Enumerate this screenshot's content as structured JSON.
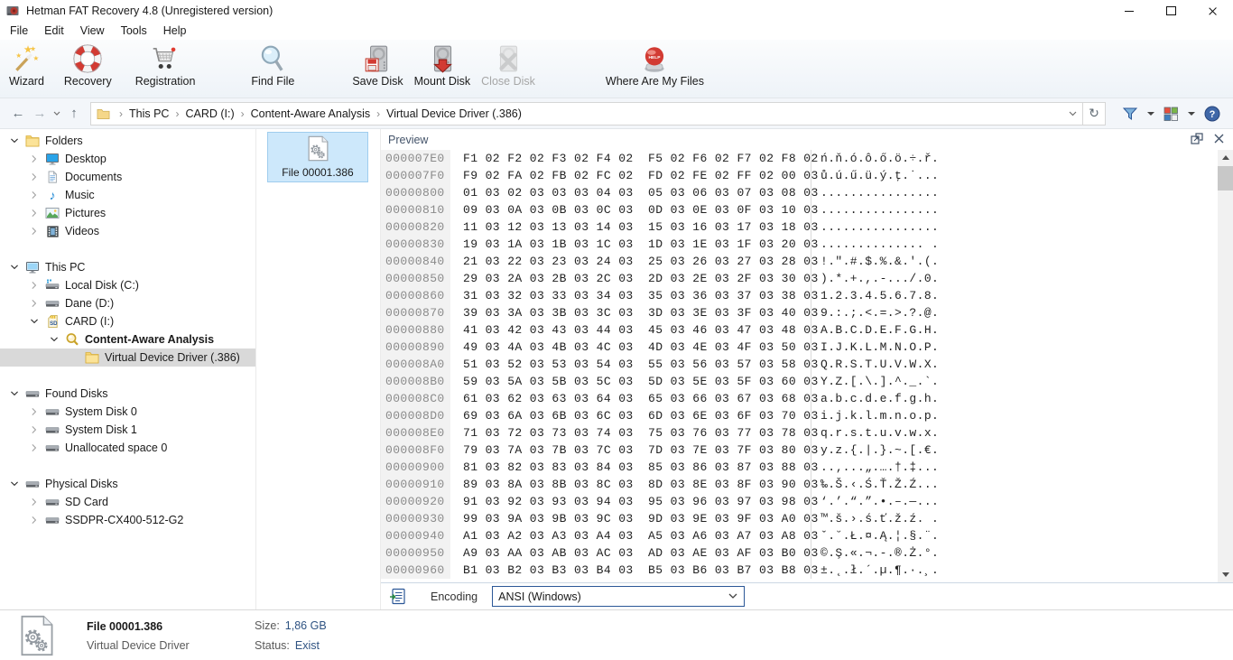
{
  "window": {
    "title": "Hetman FAT Recovery 4.8 (Unregistered version)"
  },
  "menu": {
    "items": [
      "File",
      "Edit",
      "View",
      "Tools",
      "Help"
    ]
  },
  "toolbar": {
    "buttons": [
      {
        "name": "wizard",
        "label": "Wizard",
        "icon": "wizard"
      },
      {
        "name": "recovery",
        "label": "Recovery",
        "icon": "recovery"
      },
      {
        "name": "registration",
        "label": "Registration",
        "icon": "registration"
      },
      {
        "name": "find-file",
        "label": "Find File",
        "icon": "find-file"
      },
      {
        "name": "save-disk",
        "label": "Save Disk",
        "icon": "save-disk"
      },
      {
        "name": "mount-disk",
        "label": "Mount Disk",
        "icon": "mount-disk"
      },
      {
        "name": "close-disk",
        "label": "Close Disk",
        "icon": "close-disk",
        "disabled": true
      },
      {
        "name": "where-are-my-files",
        "label": "Where Are My Files",
        "icon": "help-button"
      }
    ]
  },
  "address": {
    "breadcrumb": [
      "This PC",
      "CARD (I:)",
      "Content-Aware Analysis",
      "Virtual Device Driver (.386)"
    ]
  },
  "sidebar": {
    "items": [
      {
        "label": "Folders",
        "level": 0,
        "icon": "folder",
        "chevron": "down"
      },
      {
        "label": "Desktop",
        "level": 1,
        "icon": "desktop",
        "chevron": "right"
      },
      {
        "label": "Documents",
        "level": 1,
        "icon": "document",
        "chevron": "right"
      },
      {
        "label": "Music",
        "level": 1,
        "icon": "music",
        "chevron": "right"
      },
      {
        "label": "Pictures",
        "level": 1,
        "icon": "pictures",
        "chevron": "right"
      },
      {
        "label": "Videos",
        "level": 1,
        "icon": "videos",
        "chevron": "right"
      },
      {
        "type": "gap"
      },
      {
        "label": "This PC",
        "level": 0,
        "icon": "computer",
        "chevron": "down"
      },
      {
        "label": "Local Disk (C:)",
        "level": 1,
        "icon": "disk-c",
        "chevron": "right"
      },
      {
        "label": "Dane (D:)",
        "level": 1,
        "icon": "disk",
        "chevron": "right"
      },
      {
        "label": "CARD (I:)",
        "level": 1,
        "icon": "sd-card",
        "chevron": "down"
      },
      {
        "label": "Content-Aware Analysis",
        "level": 2,
        "icon": "search-folder",
        "chevron": "down",
        "bold": true
      },
      {
        "label": "Virtual Device Driver (.386)",
        "level": 3,
        "icon": "folder",
        "chevron": "none",
        "selected": true
      },
      {
        "type": "gap"
      },
      {
        "label": "Found Disks",
        "level": 0,
        "icon": "disk",
        "chevron": "down"
      },
      {
        "label": "System Disk 0",
        "level": 1,
        "icon": "disk",
        "chevron": "right"
      },
      {
        "label": "System Disk 1",
        "level": 1,
        "icon": "disk",
        "chevron": "right"
      },
      {
        "label": "Unallocated space 0",
        "level": 1,
        "icon": "disk",
        "chevron": "right"
      },
      {
        "type": "gap"
      },
      {
        "label": "Physical Disks",
        "level": 0,
        "icon": "disk",
        "chevron": "down"
      },
      {
        "label": "SD Card",
        "level": 1,
        "icon": "disk",
        "chevron": "right"
      },
      {
        "label": "SSDPR-CX400-512-G2",
        "level": 1,
        "icon": "disk",
        "chevron": "right"
      }
    ]
  },
  "file_list": {
    "items": [
      {
        "label": "File 00001.386",
        "selected": true
      }
    ]
  },
  "preview": {
    "title": "Preview",
    "encoding_label": "Encoding",
    "encoding_value": "ANSI (Windows)",
    "hex_rows": [
      {
        "offset": "000007E0",
        "b1": "F1 02 F2 02 F3 02 F4 02",
        "b2": "F5 02 F6 02 F7 02 F8 02",
        "ascii": "ń.ň.ó.ô.ő.ö.÷.ř."
      },
      {
        "offset": "000007F0",
        "b1": "F9 02 FA 02 FB 02 FC 02",
        "b2": "FD 02 FE 02 FF 02 00 03",
        "ascii": "ů.ú.ű.ü.ý.ţ.˙..."
      },
      {
        "offset": "00000800",
        "b1": "01 03 02 03 03 03 04 03",
        "b2": "05 03 06 03 07 03 08 03",
        "ascii": "................"
      },
      {
        "offset": "00000810",
        "b1": "09 03 0A 03 0B 03 0C 03",
        "b2": "0D 03 0E 03 0F 03 10 03",
        "ascii": "................"
      },
      {
        "offset": "00000820",
        "b1": "11 03 12 03 13 03 14 03",
        "b2": "15 03 16 03 17 03 18 03",
        "ascii": "................"
      },
      {
        "offset": "00000830",
        "b1": "19 03 1A 03 1B 03 1C 03",
        "b2": "1D 03 1E 03 1F 03 20 03",
        "ascii": ".............. ."
      },
      {
        "offset": "00000840",
        "b1": "21 03 22 03 23 03 24 03",
        "b2": "25 03 26 03 27 03 28 03",
        "ascii": "!.\".#.$.%.&.'.(."
      },
      {
        "offset": "00000850",
        "b1": "29 03 2A 03 2B 03 2C 03",
        "b2": "2D 03 2E 03 2F 03 30 03",
        "ascii": ").*.+.,.-.../.0."
      },
      {
        "offset": "00000860",
        "b1": "31 03 32 03 33 03 34 03",
        "b2": "35 03 36 03 37 03 38 03",
        "ascii": "1.2.3.4.5.6.7.8."
      },
      {
        "offset": "00000870",
        "b1": "39 03 3A 03 3B 03 3C 03",
        "b2": "3D 03 3E 03 3F 03 40 03",
        "ascii": "9.:.;.<.=.>.?.@."
      },
      {
        "offset": "00000880",
        "b1": "41 03 42 03 43 03 44 03",
        "b2": "45 03 46 03 47 03 48 03",
        "ascii": "A.B.C.D.E.F.G.H."
      },
      {
        "offset": "00000890",
        "b1": "49 03 4A 03 4B 03 4C 03",
        "b2": "4D 03 4E 03 4F 03 50 03",
        "ascii": "I.J.K.L.M.N.O.P."
      },
      {
        "offset": "000008A0",
        "b1": "51 03 52 03 53 03 54 03",
        "b2": "55 03 56 03 57 03 58 03",
        "ascii": "Q.R.S.T.U.V.W.X."
      },
      {
        "offset": "000008B0",
        "b1": "59 03 5A 03 5B 03 5C 03",
        "b2": "5D 03 5E 03 5F 03 60 03",
        "ascii": "Y.Z.[.\\.].^._.`."
      },
      {
        "offset": "000008C0",
        "b1": "61 03 62 03 63 03 64 03",
        "b2": "65 03 66 03 67 03 68 03",
        "ascii": "a.b.c.d.e.f.g.h."
      },
      {
        "offset": "000008D0",
        "b1": "69 03 6A 03 6B 03 6C 03",
        "b2": "6D 03 6E 03 6F 03 70 03",
        "ascii": "i.j.k.l.m.n.o.p."
      },
      {
        "offset": "000008E0",
        "b1": "71 03 72 03 73 03 74 03",
        "b2": "75 03 76 03 77 03 78 03",
        "ascii": "q.r.s.t.u.v.w.x."
      },
      {
        "offset": "000008F0",
        "b1": "79 03 7A 03 7B 03 7C 03",
        "b2": "7D 03 7E 03 7F 03 80 03",
        "ascii": "y.z.{.|.}.~.[.€."
      },
      {
        "offset": "00000900",
        "b1": "81 03 82 03 83 03 84 03",
        "b2": "85 03 86 03 87 03 88 03",
        "ascii": "..‚...„.….†.‡..."
      },
      {
        "offset": "00000910",
        "b1": "89 03 8A 03 8B 03 8C 03",
        "b2": "8D 03 8E 03 8F 03 90 03",
        "ascii": "‰.Š.‹.Ś.Ť.Ž.Ź..."
      },
      {
        "offset": "00000920",
        "b1": "91 03 92 03 93 03 94 03",
        "b2": "95 03 96 03 97 03 98 03",
        "ascii": "‘.’.“.”.•.–.—..."
      },
      {
        "offset": "00000930",
        "b1": "99 03 9A 03 9B 03 9C 03",
        "b2": "9D 03 9E 03 9F 03 A0 03",
        "ascii": "™.š.›.ś.ť.ž.ź. ."
      },
      {
        "offset": "00000940",
        "b1": "A1 03 A2 03 A3 03 A4 03",
        "b2": "A5 03 A6 03 A7 03 A8 03",
        "ascii": "ˇ.˘.Ł.¤.Ą.¦.§.¨."
      },
      {
        "offset": "00000950",
        "b1": "A9 03 AA 03 AB 03 AC 03",
        "b2": "AD 03 AE 03 AF 03 B0 03",
        "ascii": "©.Ş.«.¬.-.®.Ż.°."
      },
      {
        "offset": "00000960",
        "b1": "B1 03 B2 03 B3 03 B4 03",
        "b2": "B5 03 B6 03 B7 03 B8 03",
        "ascii": "±.˛.ł.´.µ.¶.·.¸."
      }
    ]
  },
  "footer": {
    "file_name": "File 00001.386",
    "file_type": "Virtual Device Driver",
    "size_label": "Size:",
    "size_value": "1,86 GB",
    "status_label": "Status:",
    "status_value": "Exist"
  },
  "colors": {
    "accent_navy": "#2b5797",
    "selection_blue": "#cde8fb",
    "selection_border": "#9fcdee",
    "tree_selection": "#d9d9d9",
    "value_text": "#2f5382",
    "offset_bg": "#f2f2f2",
    "offset_text": "#8a8a8a"
  }
}
